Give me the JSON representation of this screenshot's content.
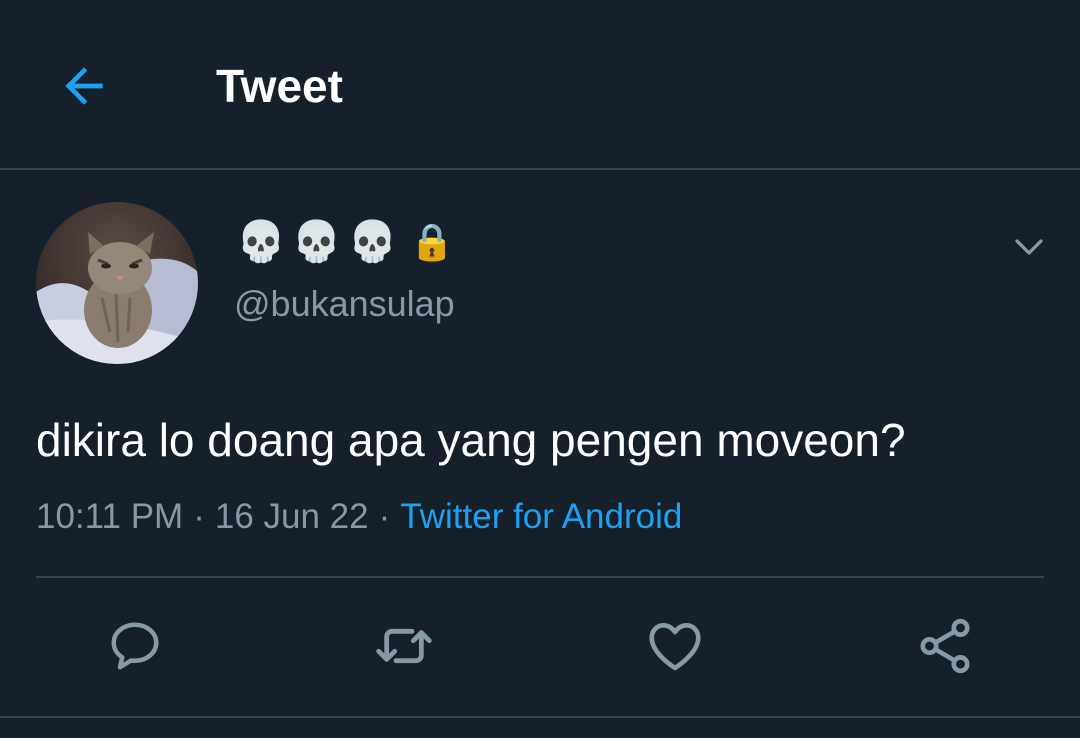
{
  "header": {
    "title": "Tweet",
    "back_icon": "arrow-left-icon"
  },
  "tweet": {
    "display_name_emojis": [
      "💀",
      "💀",
      "💀"
    ],
    "protected_icon": "🔒",
    "handle": "@bukansulap",
    "text": "dikira lo doang apa yang pengen moveon?",
    "time": "10:11 PM",
    "separator": "·",
    "date": "16 Jun 22",
    "source": "Twitter for Android"
  },
  "actions": {
    "reply_icon": "reply-icon",
    "retweet_icon": "retweet-icon",
    "like_icon": "heart-icon",
    "share_icon": "share-icon"
  },
  "colors": {
    "background": "#15202b",
    "accent": "#1da1f2",
    "muted_text": "#8899a6",
    "divider": "#38444d"
  }
}
